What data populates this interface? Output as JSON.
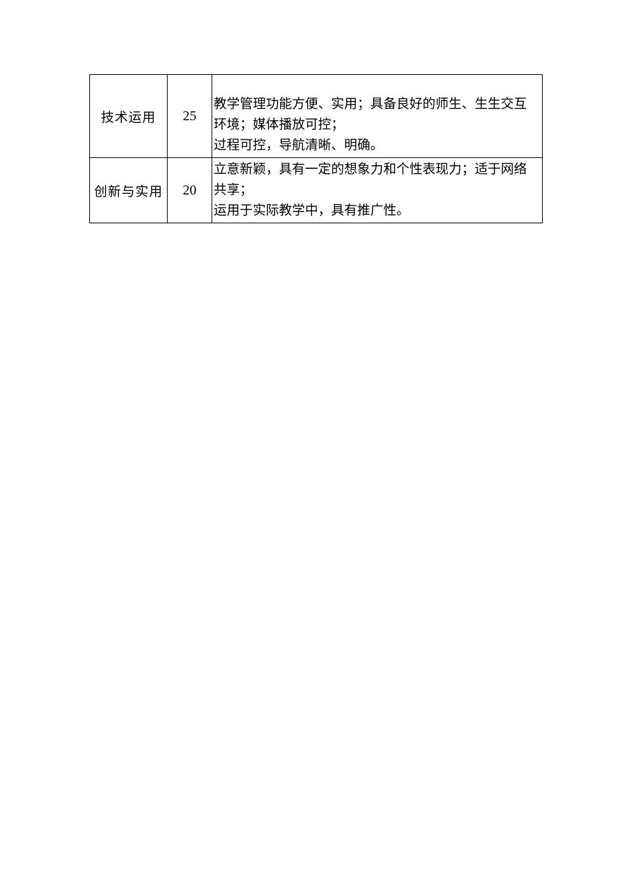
{
  "table": {
    "rows": [
      {
        "category": "技术运用",
        "score": "25",
        "description": "教学管理功能方便、实用；具备良好的师生、生生交互环境；媒体播放可控；\n过程可控，导航清晰、明确。"
      },
      {
        "category": "创新与实用",
        "score": "20",
        "description": "立意新颖，具有一定的想象力和个性表现力；适于网络共享；\n运用于实际教学中，具有推广性。"
      }
    ]
  }
}
